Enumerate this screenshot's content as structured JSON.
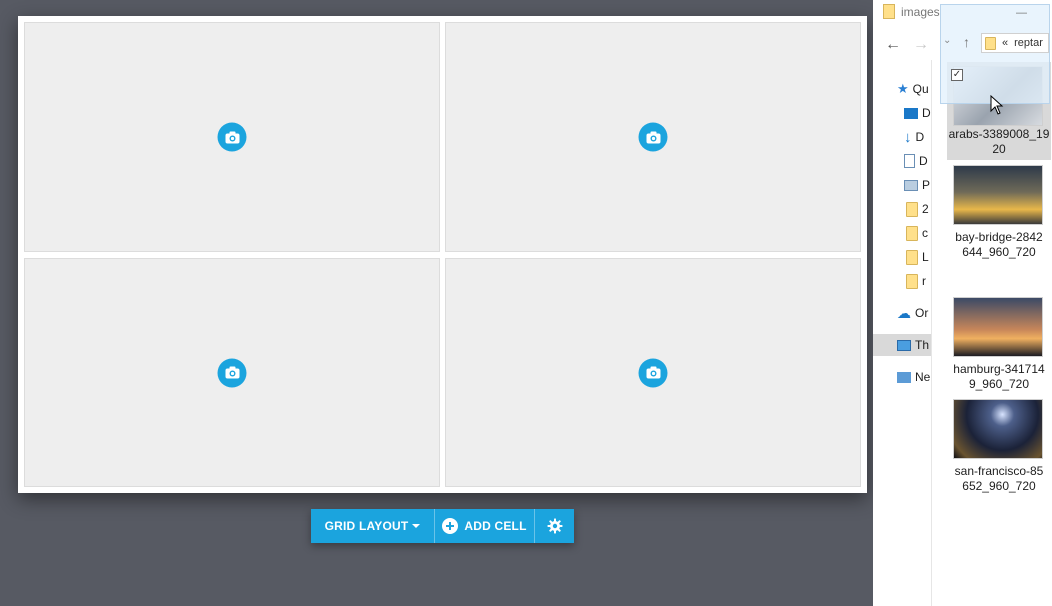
{
  "toolbar": {
    "grid_layout_label": "GRID LAYOUT",
    "add_cell_label": "ADD CELL"
  },
  "grid": {
    "cells": [
      {
        "icon": "camera-add-icon"
      },
      {
        "icon": "camera-add-icon"
      },
      {
        "icon": "camera-add-icon"
      },
      {
        "icon": "camera-add-icon"
      }
    ]
  },
  "explorer": {
    "title": "images",
    "address": "reptar",
    "address_prefix": "«",
    "nav_items": [
      {
        "label": "Qu",
        "icon": "star-icon"
      },
      {
        "label": "D",
        "icon": "desktop-icon"
      },
      {
        "label": "D",
        "icon": "download-icon"
      },
      {
        "label": "D",
        "icon": "document-icon"
      },
      {
        "label": "P",
        "icon": "pictures-icon"
      },
      {
        "label": "2",
        "icon": "folder-icon"
      },
      {
        "label": "c",
        "icon": "folder-icon"
      },
      {
        "label": "L",
        "icon": "folder-icon"
      },
      {
        "label": "r",
        "icon": "folder-icon"
      },
      {
        "label": "Or",
        "icon": "onedrive-icon"
      },
      {
        "label": "Th",
        "icon": "this-pc-icon"
      },
      {
        "label": "Ne",
        "icon": "network-icon"
      }
    ],
    "files": [
      {
        "name": "arabs-3389008_1920"
      },
      {
        "name": "bay-bridge-2842644_960_720"
      },
      {
        "name": "hamburg-3417149_960_720"
      },
      {
        "name": "san-francisco-85652_960_720"
      }
    ],
    "file_name_lines": [
      [
        "arabs-3389008_19",
        "20"
      ],
      [
        "bay-bridge-2842",
        "644_960_720"
      ],
      [
        "hamburg-341714",
        "9_960_720"
      ],
      [
        "san-francisco-85",
        "652_960_720"
      ]
    ]
  },
  "colors": {
    "accent": "#1ba4de",
    "background": "#575a63",
    "cell": "#eeeeee"
  }
}
